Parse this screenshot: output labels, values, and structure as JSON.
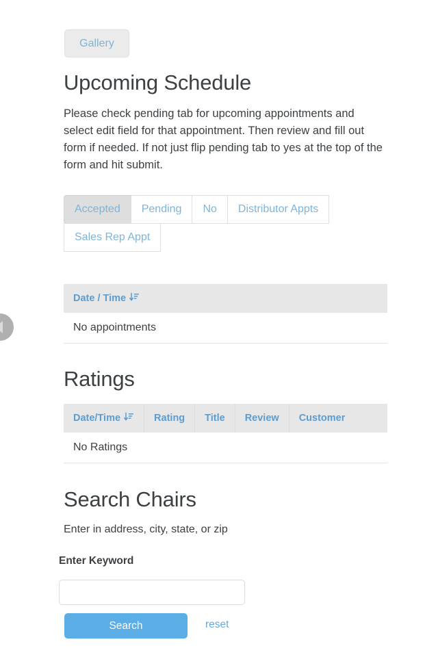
{
  "page": {
    "clipped_top_text": "."
  },
  "gallery": {
    "label": "Gallery"
  },
  "upcoming": {
    "title": "Upcoming Schedule",
    "description": "Please check pending tab for upcoming appointments and select edit field for that appointment. Then review and fill out form if needed. If not just flip pending tab to yes at the top of the form and hit submit.",
    "tabs": [
      {
        "label": "Accepted",
        "active": true
      },
      {
        "label": "Pending",
        "active": false
      },
      {
        "label": "No",
        "active": false
      },
      {
        "label": "Distributor Appts",
        "active": false
      },
      {
        "label": "Sales Rep Appt",
        "active": false
      }
    ],
    "table": {
      "columns": [
        "Date / Time"
      ],
      "sort_icon": "sort-amount-down-icon",
      "empty_message": "No appointments"
    },
    "carousel_prev_icon": "chevron-left-icon"
  },
  "ratings": {
    "title": "Ratings",
    "table": {
      "columns": [
        "Date/Time",
        "Rating",
        "Title",
        "Review",
        "Customer"
      ],
      "sort_icon": "sort-amount-down-icon",
      "empty_message": "No Ratings"
    }
  },
  "search": {
    "title": "Search Chairs",
    "subtitle": "Enter in address, city, state, or zip",
    "keyword_label": "Enter Keyword",
    "keyword_value": "",
    "keyword_placeholder": "",
    "search_button": "Search",
    "reset_link": "reset"
  },
  "colors": {
    "link_blue": "#7fb4d6",
    "header_blue": "#5c9ccf",
    "button_blue": "#5bade5",
    "tab_active_bg": "#dededf",
    "table_header_bg": "#e7e7e8",
    "text": "#3c4043"
  }
}
